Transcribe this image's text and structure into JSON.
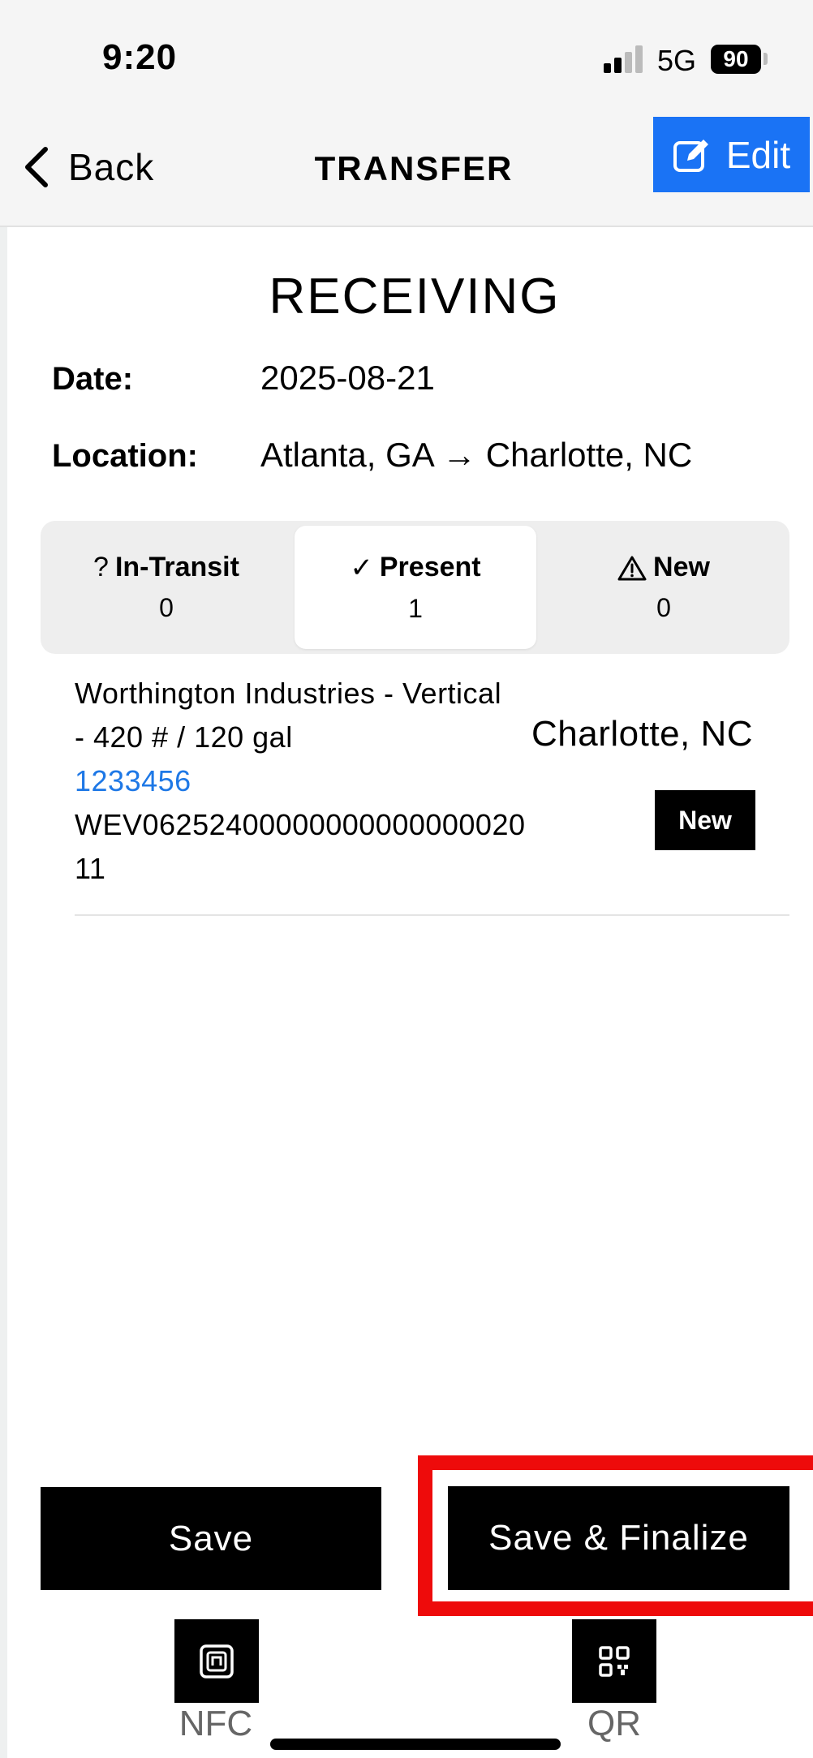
{
  "status_bar": {
    "time": "9:20",
    "network": "5G",
    "battery": "90"
  },
  "navbar": {
    "back_label": "Back",
    "title": "TRANSFER",
    "edit_label": "Edit",
    "accent_color": "#1a73f5"
  },
  "page": {
    "heading": "RECEIVING",
    "date_label": "Date:",
    "date_value": "2025-08-21",
    "location_label": "Location:",
    "location_value": "Atlanta, GA → Charlotte, NC"
  },
  "tabs": [
    {
      "icon": "?",
      "label": "In-Transit",
      "count": "0"
    },
    {
      "icon": "✓",
      "label": "Present",
      "count": "1",
      "active": true
    },
    {
      "icon": "warning-icon",
      "label": "New",
      "count": "0"
    }
  ],
  "items": [
    {
      "name_line1": "Worthington Industries - Vertical",
      "name_line2": "- 420 # / 120 gal",
      "serial": "1233456",
      "code_line1": "WEV06252400000000000000020",
      "code_line2": "11",
      "location": "Charlotte, NC",
      "badge": "New"
    }
  ],
  "actions": {
    "save_label": "Save",
    "finalize_label": "Save & Finalize",
    "highlight_color": "#ee0b0b"
  },
  "bottom_tabs": {
    "nfc_label": "NFC",
    "qr_label": "QR"
  }
}
